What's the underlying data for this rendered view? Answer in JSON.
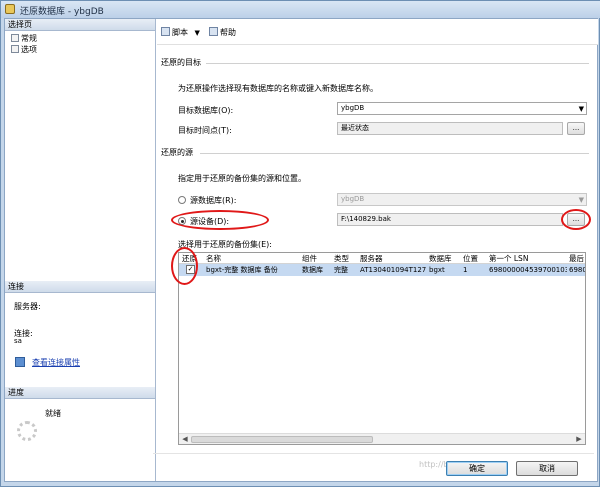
{
  "window": {
    "title": "还原数据库 - ybgDB"
  },
  "left_pane": {
    "select_page_header": "选择页",
    "pages": [
      {
        "label": "常规"
      },
      {
        "label": "选项"
      }
    ],
    "connection_header": "连接",
    "server_label": "服务器:",
    "connection_label": "连接:",
    "connection_value": "sa",
    "view_connection_link": "查看连接属性",
    "progress_header": "进度",
    "progress_status": "就绪"
  },
  "toolbar": {
    "script_label": "脚本",
    "help_label": "帮助"
  },
  "restore_target": {
    "section_title": "还原的目标",
    "instruction": "为还原操作选择现有数据库的名称或键入新数据库名称。",
    "target_db_label": "目标数据库(O):",
    "target_db_value": "ybgDB",
    "target_time_label": "目标时间点(T):",
    "target_time_value": "最近状态"
  },
  "restore_source": {
    "section_title": "还原的源",
    "instruction": "指定用于还原的备份集的源和位置。",
    "source_db_label": "源数据库(R):",
    "source_db_value": "ybgDB",
    "source_device_label": "源设备(D):",
    "source_device_value": "F:\\140829.bak",
    "backup_sets_label": "选择用于还原的备份集(E):",
    "selected_option": "源设备"
  },
  "backup_grid": {
    "columns": [
      "还原",
      "名称",
      "组件",
      "类型",
      "服务器",
      "数据库",
      "位置",
      "第一个 LSN",
      "最后"
    ],
    "rows": [
      {
        "restore": true,
        "name": "bgxt-完整 数据库 备份",
        "component": "数据库",
        "type": "完整",
        "server": "AT130401094T127",
        "database": "bgxt",
        "position": "1",
        "first_lsn": "69800000453970010З",
        "last": "6980"
      }
    ]
  },
  "buttons": {
    "ok_label": "确定",
    "cancel_label": "取消"
  },
  "watermark": "http://blog.csdn.net/..."
}
